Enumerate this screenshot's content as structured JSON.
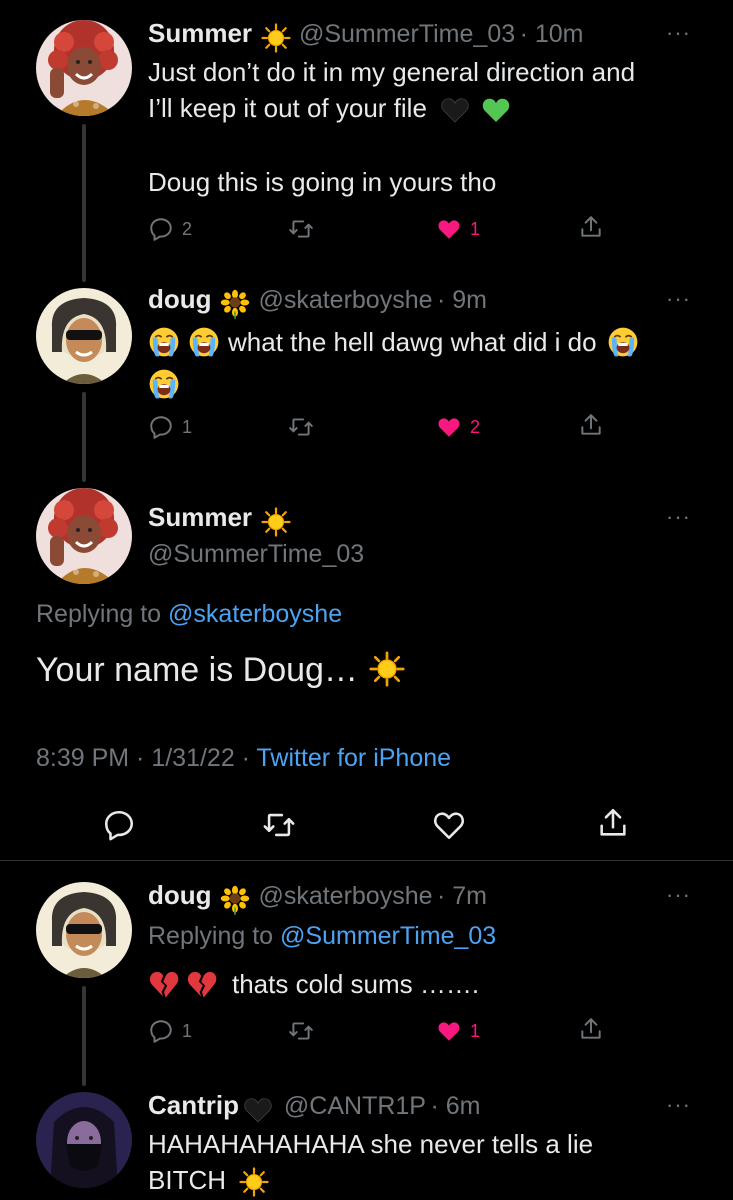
{
  "tweets": [
    {
      "name": "Summer",
      "badge_icon": "sun-emoji",
      "handle": "@SummerTime_03",
      "time": "· 10m",
      "lines": [
        "Just don’t do it in my general direction and",
        "I’ll keep it out of your file"
      ],
      "line2_emojis": [
        "black-heart-emoji",
        "green-heart-emoji"
      ],
      "line3": "Doug this is going in yours tho",
      "replies": "2",
      "likes": "1",
      "liked": true
    },
    {
      "name": "doug",
      "badge_icon": "sunflower-emoji",
      "handle": "@skaterboyshe",
      "time": "· 9m",
      "text": "what the hell dawg what did i do",
      "replies": "1",
      "likes": "2",
      "liked": true
    },
    {
      "name": "doug",
      "badge_icon": "sunflower-emoji",
      "handle": "@skaterboyshe",
      "time": "· 7m",
      "replying_prefix": "Replying to",
      "replying_to": "@SummerTime_03",
      "text": "thats cold sums …….",
      "replies": "1",
      "likes": "1",
      "liked": true
    },
    {
      "name": "Cantrip",
      "badge_icon": "black-heart-emoji",
      "handle": "@CANTR1P",
      "time": "· 6m",
      "lines": [
        "HAHAHAHAHAHA she never tells a lie",
        "BITCH"
      ]
    }
  ],
  "focused": {
    "name": "Summer",
    "handle": "@SummerTime_03",
    "replying_prefix": "Replying to",
    "replying_to": "@skaterboyshe",
    "text": "Your name is Doug…",
    "timestamp": "8:39 PM · 1/31/22 ·",
    "client": "Twitter for iPhone"
  },
  "colors": {
    "background": "#000000",
    "text": "#e7e9ea",
    "muted": "#71767b",
    "link": "#4da3f2",
    "like": "#f91880"
  }
}
